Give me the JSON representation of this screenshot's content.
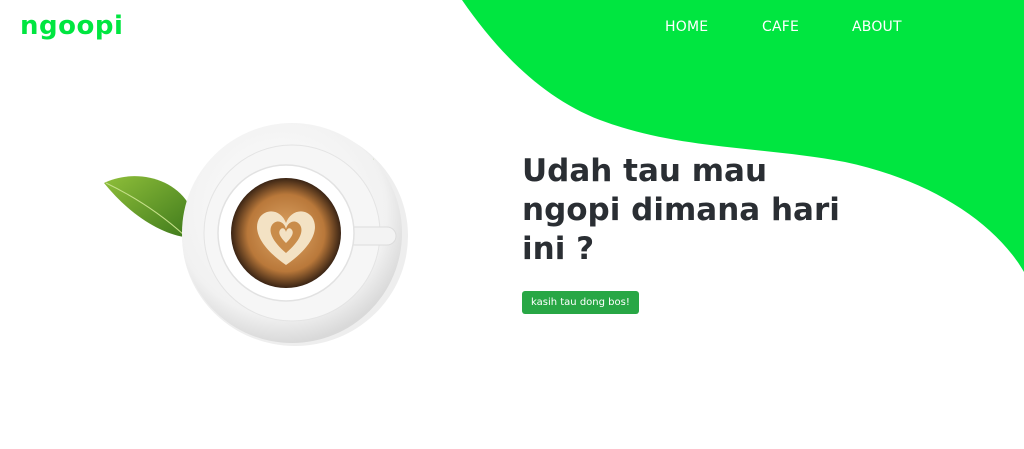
{
  "brand": {
    "name": "ngoopi",
    "color": "#00e640"
  },
  "nav": {
    "items": [
      {
        "label": "HOME"
      },
      {
        "label": "CAFE"
      },
      {
        "label": "ABOUT"
      }
    ]
  },
  "hero": {
    "headline": "Udah tau mau ngopi dimana hari ini ?",
    "cta_label": "kasih tau dong bos!",
    "image_icon": "coffee-cup-with-leaves"
  },
  "colors": {
    "accent": "#00e640",
    "button": "#28a745",
    "headline": "#2a2e33"
  }
}
